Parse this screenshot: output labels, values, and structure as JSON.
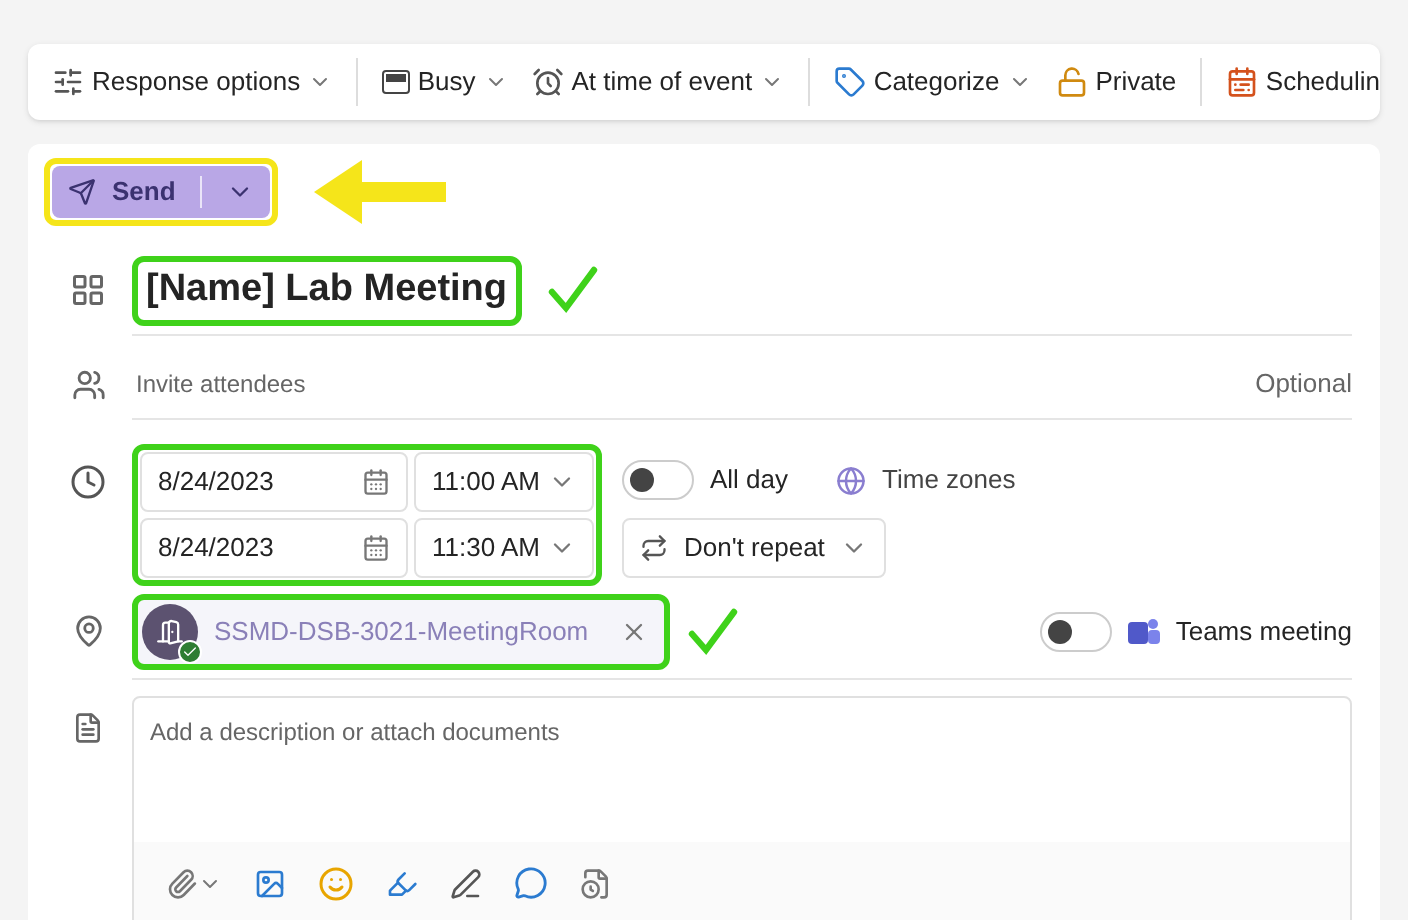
{
  "toolbar": [
    {
      "kind": "sliders",
      "label": "Response options",
      "dropdown": true
    },
    {
      "kind": "busy",
      "label": "Busy",
      "dropdown": true
    },
    {
      "kind": "alarm",
      "label": "At time of event",
      "dropdown": true
    },
    {
      "kind": "tag",
      "label": "Categorize",
      "dropdown": true
    },
    {
      "kind": "lock",
      "label": "Private",
      "dropdown": false
    },
    {
      "kind": "calendar",
      "label": "Schedulin",
      "dropdown": false
    }
  ],
  "send_button": {
    "label": "Send",
    "highlighted": true
  },
  "title": {
    "value": "[Name] Lab Meeting",
    "highlighted": true
  },
  "attendees": {
    "placeholder": "Invite attendees",
    "optional_link": "Optional"
  },
  "start": {
    "date": "8/24/2023",
    "time": "11:00 AM"
  },
  "end": {
    "date": "8/24/2023",
    "time": "11:30 AM"
  },
  "all_day": {
    "label": "All day",
    "on": false
  },
  "time_zones": "Time zones",
  "repeat": "Don't repeat",
  "location": {
    "room": "SSMD-DSB-3021-MeetingRoom",
    "highlighted": true
  },
  "teams_meeting": {
    "label": "Teams meeting",
    "on": false
  },
  "description": {
    "placeholder": "Add a description or attach documents"
  }
}
